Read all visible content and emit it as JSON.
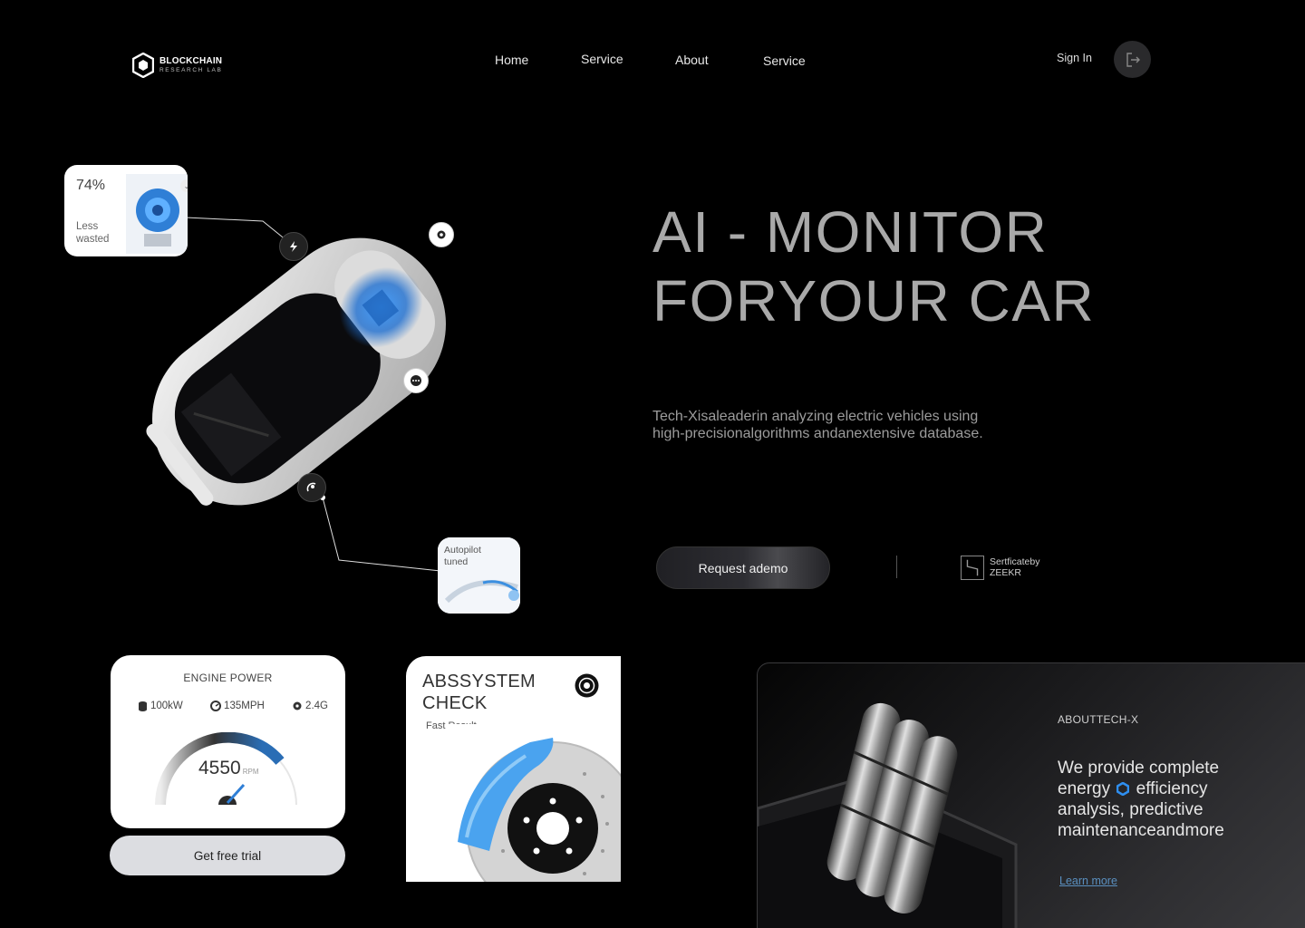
{
  "header": {
    "logo_main": "BLOCKCHAIN",
    "logo_sub": "RESEARCH LAB",
    "nav": [
      "Home",
      "Service",
      "About",
      "Service"
    ],
    "sign_in": "Sign In"
  },
  "hero": {
    "title_line1": "AI - MONITOR",
    "title_line2": "FORYOUR CAR",
    "description": "Tech-Xisaleaderin analyzing electric vehicles using high-precisionalgorithms andanextensive database.",
    "demo_button": "Request ademo",
    "cert_line1": "Sertficateby",
    "cert_line2": "ZEEKR"
  },
  "callouts": {
    "engine_percent": "74%",
    "engine_label_1": "Less",
    "engine_label_2": "wasted",
    "autopilot_1": "Autopilot",
    "autopilot_2": "tuned"
  },
  "engine": {
    "title": "ENGINE POWER",
    "stat_power": "100kW",
    "stat_speed": "135MPH",
    "stat_gear": "2.4G",
    "rpm_value": "4550",
    "rpm_unit": "RPM",
    "trial_button": "Get free trial"
  },
  "abs": {
    "title_line1": "ABSSYSTEM",
    "title_line2": "CHECK",
    "subtitle": "Fast Result"
  },
  "about": {
    "heading": "ABOUTTECH-X",
    "text_part1": "We provide complete energy",
    "text_part2": "efficiency analysis, predictive maintenanceandmore",
    "learn_more": "Learn more"
  },
  "colors": {
    "background": "#000000",
    "accent_blue": "#2f7fd6",
    "link": "#5a8fbf"
  }
}
